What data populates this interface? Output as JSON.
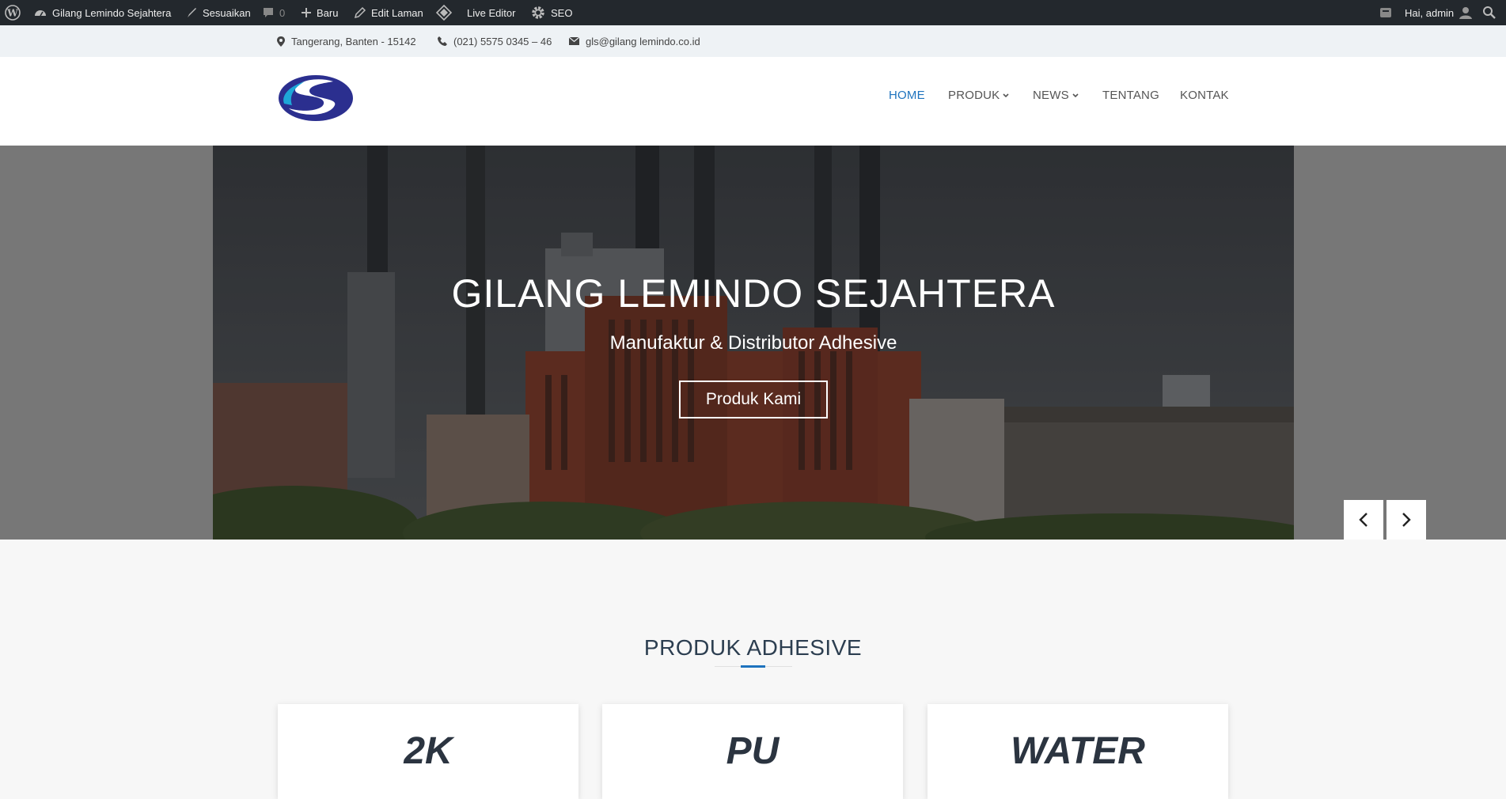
{
  "adminbar": {
    "site_name": "Gilang Lemindo Sejahtera",
    "customize": "Sesuaikan",
    "comments_count": "0",
    "new": "Baru",
    "edit_page": "Edit Laman",
    "live_editor": "Live Editor",
    "seo": "SEO",
    "greeting": "Hai, admin"
  },
  "infobar": {
    "location": "Tangerang, Banten - 15142",
    "phone": "(021) 5575 0345 – 46",
    "email": "gls@gilang lemindo.co.id"
  },
  "nav": {
    "home": "HOME",
    "produk": "PRODUK",
    "news": "NEWS",
    "tentang": "TENTANG",
    "kontak": "KONTAK"
  },
  "hero": {
    "title": "GILANG LEMINDO SEJAHTERA",
    "subtitle": "Manufaktur & Distributor Adhesive",
    "button": "Produk Kami"
  },
  "products": {
    "title": "PRODUK ADHESIVE",
    "cards": [
      "2K",
      "PU",
      "WATER"
    ]
  },
  "colors": {
    "adminbar": "#23282d",
    "accent": "#1e73be",
    "logo_blue": "#2b2f8f",
    "logo_cyan": "#1ea7d8"
  }
}
